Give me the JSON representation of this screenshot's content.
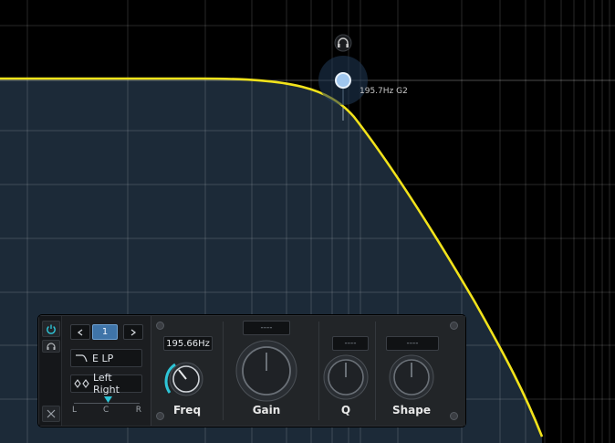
{
  "node": {
    "frequency_hz": 195.7,
    "note": "G2",
    "label": "195.7Hz G2",
    "listen_icon": "headphones-icon"
  },
  "filter_panel": {
    "band": {
      "prev_icon": "chevron-left-icon",
      "number": "1",
      "next_icon": "chevron-right-icon"
    },
    "filter_type": {
      "label": "E LP",
      "icon": "lowpass-shape-icon"
    },
    "channel": {
      "label": "Left Right",
      "icon": "stereo-link-icon"
    },
    "pan": {
      "left": "L",
      "center": "C",
      "right": "R",
      "position": 0.5
    },
    "side_buttons": {
      "power_icon": "power-icon",
      "listen_icon": "headphones-icon",
      "close_icon": "close-icon"
    },
    "knobs": {
      "freq": {
        "label": "Freq",
        "value": "195.66Hz"
      },
      "gain": {
        "label": "Gain",
        "value": "----"
      },
      "q": {
        "label": "Q",
        "value": "----"
      },
      "shape": {
        "label": "Shape",
        "value": "----"
      }
    }
  },
  "colors": {
    "curve": "#f2e31b",
    "fill": "#1c2a38",
    "node": "#9fc6ee",
    "accent": "#2ec4d6",
    "band_select": "#3f74a8"
  }
}
